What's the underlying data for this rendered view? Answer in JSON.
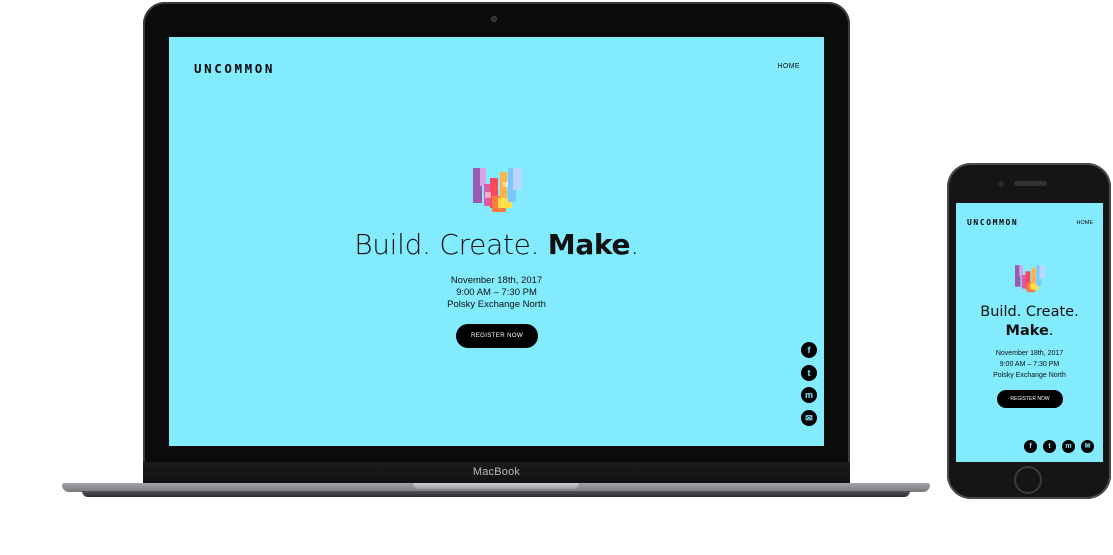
{
  "brand": "UNCOMMON",
  "nav": {
    "home": "HOME"
  },
  "hero": {
    "headline_light": "Build. Create.",
    "headline_bold": "Make",
    "headline_end": ".",
    "date": "November 18th, 2017",
    "time": "9:00 AM – 7:30 PM",
    "venue": "Polsky Exchange North",
    "cta": "REGISTER NOW"
  },
  "social": [
    {
      "icon": "facebook-icon",
      "glyph": "f"
    },
    {
      "icon": "twitter-icon",
      "glyph": "t"
    },
    {
      "icon": "messenger-icon",
      "glyph": "m"
    },
    {
      "icon": "email-icon",
      "glyph": "✉"
    }
  ],
  "device": {
    "laptop_label": "MacBook"
  },
  "colors": {
    "background": "#82ebfd",
    "text": "#111111",
    "button": "#000000"
  }
}
